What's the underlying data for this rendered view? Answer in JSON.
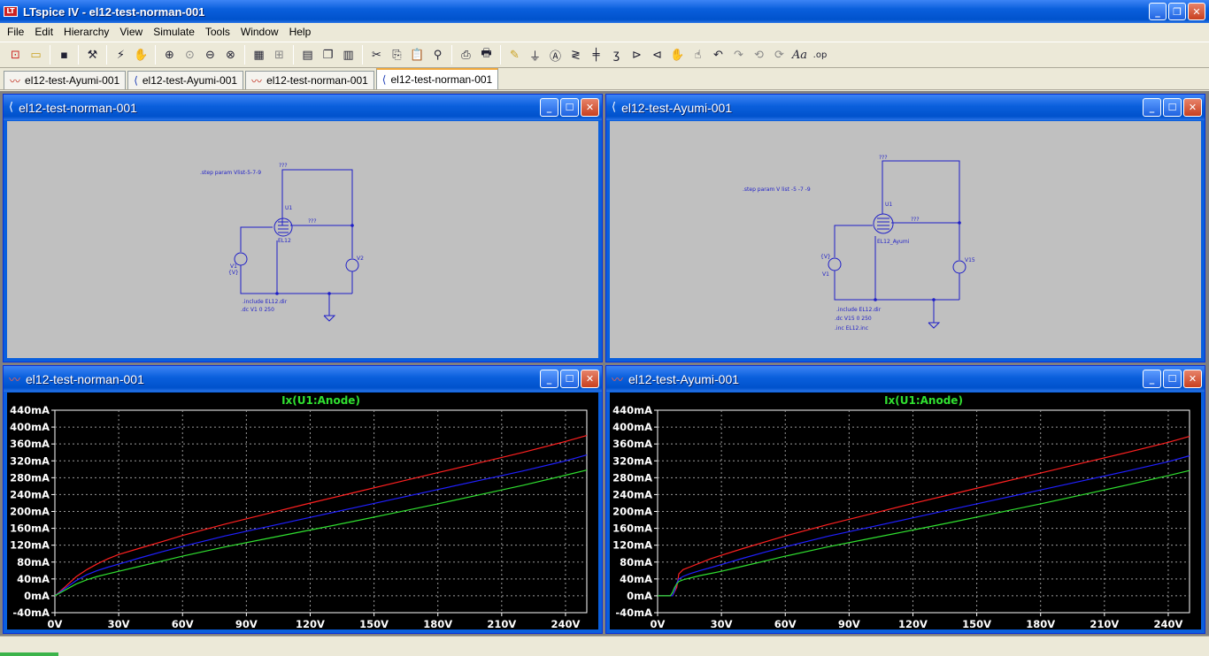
{
  "app": {
    "title": "LTspice IV - el12-test-norman-001",
    "icon_text": "LT"
  },
  "menu": [
    "File",
    "Edit",
    "Hierarchy",
    "View",
    "Simulate",
    "Tools",
    "Window",
    "Help"
  ],
  "tabs": [
    {
      "label": "el12-test-Ayumi-001",
      "type": "waveform"
    },
    {
      "label": "el12-test-Ayumi-001",
      "type": "schematic"
    },
    {
      "label": "el12-test-norman-001",
      "type": "waveform"
    },
    {
      "label": "el12-test-norman-001",
      "type": "schematic",
      "active": true
    }
  ],
  "windows": {
    "schem_left": {
      "title": "el12-test-norman-001",
      "directive_step": ".step param Vlist-5-7-9",
      "directive_inc": ".include EL12.dir",
      "directive_dc": ".dc V1 0 250",
      "tube_label": "U1",
      "tube_model": "EL12",
      "src_left": "V1",
      "src_left_val": "{V}",
      "src_right": "V2",
      "net1": "???",
      "net2": "???"
    },
    "schem_right": {
      "title": "el12-test-Ayumi-001",
      "directive_step": ".step param V list -5 -7 -9",
      "directive_inc": ".include EL12.dir",
      "directive_dc": ".dc V15 0 250",
      "directive_inc2": ".inc EL12.inc",
      "tube_label": "U1",
      "tube_model": "EL12_Ayumi",
      "src_left": "V1",
      "src_left_val": "{V}",
      "src_right": "V15",
      "net1": "???",
      "net2": "???"
    },
    "plot_left": {
      "title": "el12-test-norman-001"
    },
    "plot_right": {
      "title": "el12-test-Ayumi-001"
    }
  },
  "colors": {
    "trace_red": "#ff2020",
    "trace_blue": "#2020ff",
    "trace_green": "#30e030",
    "plot_bg": "#000000",
    "wire": "#1e1ec8"
  },
  "chart_data": [
    {
      "type": "line",
      "title": "Ix(U1:Anode)",
      "xlim": [
        0,
        250
      ],
      "ylim": [
        -40,
        440
      ],
      "x_ticks": [
        "0V",
        "30V",
        "60V",
        "90V",
        "120V",
        "150V",
        "180V",
        "210V",
        "240V"
      ],
      "y_ticks": [
        "-40mA",
        "0mA",
        "40mA",
        "80mA",
        "120mA",
        "160mA",
        "200mA",
        "240mA",
        "280mA",
        "320mA",
        "360mA",
        "400mA",
        "440mA"
      ],
      "grid": true,
      "series": [
        {
          "color": "red",
          "x": [
            0,
            5,
            10,
            15,
            20,
            25,
            30,
            40,
            50,
            60,
            80,
            100,
            120,
            140,
            160,
            180,
            200,
            220,
            240,
            250
          ],
          "y": [
            0,
            22,
            45,
            62,
            76,
            88,
            98,
            113,
            128,
            143,
            170,
            195,
            220,
            244,
            268,
            292,
            316,
            340,
            366,
            380
          ]
        },
        {
          "color": "blue",
          "x": [
            0,
            5,
            10,
            15,
            20,
            25,
            30,
            40,
            50,
            60,
            80,
            100,
            120,
            140,
            160,
            180,
            200,
            220,
            240,
            250
          ],
          "y": [
            0,
            18,
            36,
            50,
            60,
            68,
            75,
            90,
            104,
            117,
            142,
            164,
            186,
            208,
            230,
            252,
            274,
            296,
            320,
            334
          ]
        },
        {
          "color": "green",
          "x": [
            0,
            5,
            10,
            15,
            20,
            25,
            30,
            40,
            50,
            60,
            80,
            100,
            120,
            140,
            160,
            180,
            200,
            220,
            240,
            250
          ],
          "y": [
            0,
            14,
            28,
            38,
            46,
            52,
            58,
            70,
            82,
            94,
            116,
            136,
            156,
            176,
            197,
            218,
            240,
            262,
            286,
            298
          ]
        }
      ]
    },
    {
      "type": "line",
      "title": "Ix(U1:Anode)",
      "xlim": [
        0,
        250
      ],
      "ylim": [
        -40,
        440
      ],
      "x_ticks": [
        "0V",
        "30V",
        "60V",
        "90V",
        "120V",
        "150V",
        "180V",
        "210V",
        "240V"
      ],
      "y_ticks": [
        "-40mA",
        "0mA",
        "40mA",
        "80mA",
        "120mA",
        "160mA",
        "200mA",
        "240mA",
        "280mA",
        "320mA",
        "360mA",
        "400mA",
        "440mA"
      ],
      "grid": true,
      "series": [
        {
          "color": "red",
          "x": [
            0,
            5,
            7,
            9,
            10,
            12,
            15,
            20,
            25,
            30,
            40,
            50,
            60,
            80,
            100,
            120,
            140,
            160,
            180,
            200,
            220,
            240,
            250
          ],
          "y": [
            0,
            0,
            0,
            20,
            52,
            62,
            68,
            78,
            88,
            96,
            112,
            127,
            142,
            169,
            194,
            219,
            243,
            267,
            291,
            315,
            339,
            364,
            378
          ]
        },
        {
          "color": "blue",
          "x": [
            0,
            5,
            7,
            8,
            9,
            10,
            12,
            15,
            20,
            25,
            30,
            40,
            50,
            60,
            80,
            100,
            120,
            140,
            160,
            180,
            200,
            220,
            240,
            250
          ],
          "y": [
            0,
            0,
            0,
            12,
            30,
            40,
            46,
            52,
            60,
            67,
            74,
            89,
            103,
            116,
            141,
            163,
            185,
            207,
            229,
            251,
            273,
            295,
            318,
            332
          ]
        },
        {
          "color": "green",
          "x": [
            0,
            5,
            6,
            7,
            8,
            9,
            10,
            12,
            15,
            20,
            25,
            30,
            40,
            50,
            60,
            80,
            100,
            120,
            140,
            160,
            180,
            200,
            220,
            240,
            250
          ],
          "y": [
            0,
            0,
            0,
            8,
            20,
            28,
            34,
            38,
            42,
            48,
            53,
            58,
            70,
            82,
            94,
            116,
            136,
            156,
            176,
            197,
            218,
            240,
            262,
            285,
            297
          ]
        }
      ]
    }
  ]
}
